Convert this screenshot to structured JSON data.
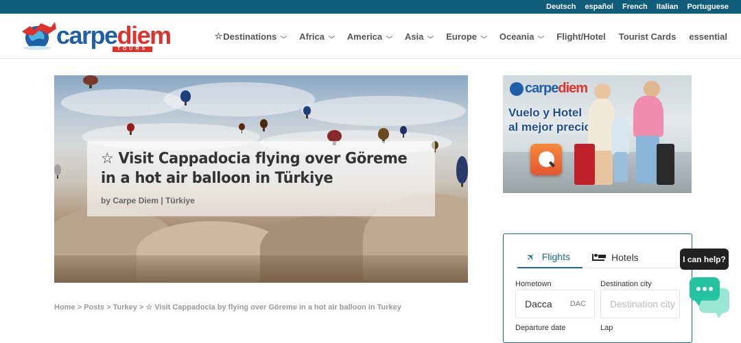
{
  "languages": [
    "Deutsch",
    "español",
    "French",
    "Italian",
    "Portuguese"
  ],
  "logo": {
    "part1": "carpe",
    "part2": "diem",
    "tagline": "TOURS"
  },
  "nav": [
    {
      "label": "Destinations",
      "has_star": true,
      "has_chevron": true
    },
    {
      "label": "Africa",
      "has_chevron": true
    },
    {
      "label": "America",
      "has_chevron": true
    },
    {
      "label": "Asia",
      "has_chevron": true
    },
    {
      "label": "Europe",
      "has_chevron": true
    },
    {
      "label": "Oceania",
      "has_chevron": true
    },
    {
      "label": "Flight/Hotel",
      "has_chevron": false
    },
    {
      "label": "Tourist Cards",
      "has_chevron": false
    },
    {
      "label": "essential",
      "has_chevron": false
    }
  ],
  "post": {
    "title": "☆ Visit Cappadocia flying over Göreme in a hot air balloon in Türkiye",
    "meta_prefix": "by ",
    "author": "Carpe Diem",
    "meta_sep": " | ",
    "category": "Türkiye"
  },
  "breadcrumb": "Home > Posts > Turkey > ☆ Visit Cappadocia by flying over Göreme in a hot air balloon in Turkey",
  "ad": {
    "logo_part1": "carpe",
    "logo_part2": "diem",
    "line1": "Vuelo y Hotel",
    "line2": "al mejor precio"
  },
  "booking": {
    "tabs": {
      "flights": "Flights",
      "hotels": "Hotels"
    },
    "hometown_label": "Hometown",
    "hometown_value": "Dacca",
    "hometown_code": "DAC",
    "destination_label": "Destination city",
    "destination_placeholder": "Destination city",
    "departure_label": "Departure date",
    "lap_label": "Lap"
  },
  "chat": {
    "bubble": "I can help?"
  },
  "colors": {
    "topbar": "#0f5d7a",
    "accent": "#1a6b8a",
    "chat": "#25c4a0",
    "logo_blue": "#1f5fa8",
    "logo_red": "#e0322c"
  }
}
